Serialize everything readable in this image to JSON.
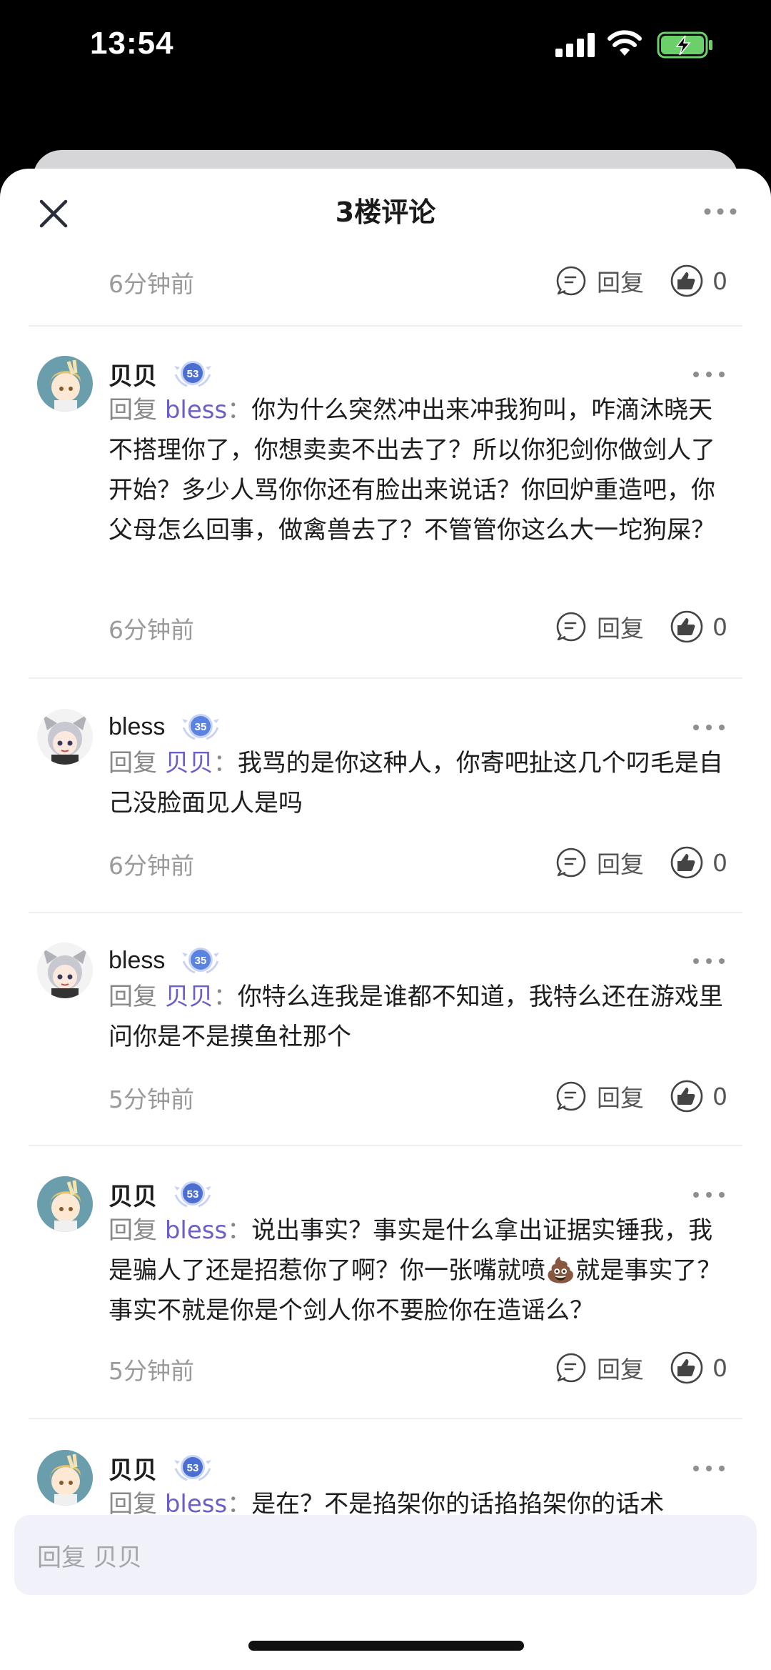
{
  "status_bar": {
    "time": "13:54"
  },
  "header": {
    "title": "3楼评论"
  },
  "top_meta": {
    "time": "6分钟前",
    "reply_label": "回复",
    "like_count": "0"
  },
  "comments": [
    {
      "author": "贝贝",
      "level": "53",
      "reply_prefix": "回复 ",
      "reply_to": "bless",
      "colon": "：",
      "text": "你为什么突然冲出来冲我狗叫，咋滴沐晓天不搭理你了，你想卖卖不出去了？所以你犯剑你做剑人了开始？多少人骂你你还有脸出来说话？你回炉重造吧，你父母怎么回事，做禽兽去了？不管管你这么大一坨狗屎？",
      "time": "6分钟前",
      "reply_label": "回复",
      "like_count": "0"
    },
    {
      "author": "bless",
      "level": "35",
      "reply_prefix": "回复 ",
      "reply_to": "贝贝",
      "colon": "：",
      "text": "我骂的是你这种人，你寄吧扯这几个叼毛是自己没脸面见人是吗",
      "time": "6分钟前",
      "reply_label": "回复",
      "like_count": "0"
    },
    {
      "author": "bless",
      "level": "35",
      "reply_prefix": "回复 ",
      "reply_to": "贝贝",
      "colon": "：",
      "text": "你特么连我是谁都不知道，我特么还在游戏里问你是不是摸鱼社那个",
      "time": "5分钟前",
      "reply_label": "回复",
      "like_count": "0"
    },
    {
      "author": "贝贝",
      "level": "53",
      "reply_prefix": "回复 ",
      "reply_to": "bless",
      "colon": "：",
      "text": "说出事实？事实是什么拿出证据实锤我，我是骗人了还是招惹你了啊？你一张嘴就喷💩就是事实了？事实不就是你是个剑人你不要脸你在造谣么？",
      "time": "5分钟前",
      "reply_label": "回复",
      "like_count": "0"
    },
    {
      "author": "贝贝",
      "level": "53",
      "reply_prefix": "回复 ",
      "reply_to": "bless",
      "colon": "：",
      "text": "是在？不是掐架你的话掐掐架你的话术",
      "time": "",
      "reply_label": "",
      "like_count": ""
    }
  ],
  "input": {
    "placeholder": "回复 贝贝"
  },
  "colors": {
    "accent": "#6a5fc8",
    "badge": "#4a6fd0",
    "input_bg": "#f1f2f9"
  }
}
